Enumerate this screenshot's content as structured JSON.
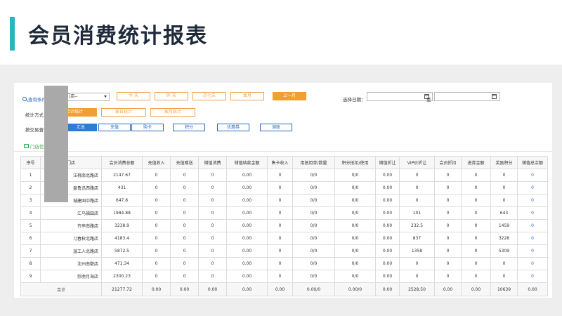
{
  "slide": {
    "title": "会员消费统计报表"
  },
  "query": {
    "label": "查询条件",
    "store_select": "--所有门店--",
    "quick_buttons": [
      {
        "label": "今 天",
        "active": false
      },
      {
        "label": "昨 天",
        "active": false
      },
      {
        "label": "近七天",
        "active": false
      },
      {
        "label": "本月",
        "active": false
      },
      {
        "label": "上一月",
        "active": true
      }
    ],
    "date_label": "选择日期：",
    "date_from": "",
    "date_to": "",
    "date_sep": "至"
  },
  "stat_mode": {
    "label": "统计方式：",
    "buttons": [
      {
        "label": "合计统计",
        "active": true
      },
      {
        "label": "按日统计",
        "active": false
      },
      {
        "label": "按月统计",
        "active": false
      }
    ]
  },
  "trade_query": {
    "label": "按交易查询：",
    "buttons": [
      {
        "label": "汇总",
        "active": true
      },
      {
        "label": "充值",
        "active": false
      },
      {
        "label": "购卡",
        "active": false
      },
      {
        "label": "积分",
        "active": false
      },
      {
        "label": "优惠券",
        "active": false
      },
      {
        "label": "调账",
        "active": false
      }
    ]
  },
  "section_tab": "门店信息",
  "table": {
    "headers": [
      "序号",
      "门店",
      "会员消费总额",
      "充值收入",
      "充值赠送",
      "储值消费",
      "储值结款金额",
      "售卡收入",
      "用抵用劵/数量",
      "积分抵扣/使用",
      "储值折让",
      "VIP价折让",
      "会员折扣",
      "进券金额",
      "奖励积分",
      "储值总余额"
    ],
    "rows": [
      [
        "1",
        "汪桃南北路店",
        "2147.67",
        "0",
        "0",
        "0",
        "0.00",
        "0",
        "0/0",
        "0/0",
        "0.00",
        "0",
        "0",
        "0",
        "0",
        "0"
      ],
      [
        "2",
        "盘鲁迅西路店",
        "431",
        "0",
        "0",
        "0",
        "0.00",
        "0",
        "0/0",
        "0/0",
        "0.00",
        "0",
        "0",
        "0",
        "0",
        "0"
      ],
      [
        "3",
        "城建国中路店",
        "647.8",
        "0",
        "0",
        "0",
        "0.00",
        "0",
        "0/0",
        "0/0",
        "0.00",
        "0",
        "0",
        "0",
        "0",
        "0"
      ],
      [
        "4",
        "汇乌福田店",
        "1984.88",
        "0",
        "0",
        "0",
        "0.00",
        "0",
        "0/0",
        "0/0",
        "0.00",
        "101",
        "0",
        "0",
        "643",
        "0"
      ],
      [
        "5",
        "齐亭南路店",
        "3238.9",
        "0",
        "0",
        "0",
        "0.00",
        "0",
        "0/0",
        "0/0",
        "0.00",
        "232.5",
        "0",
        "0",
        "1459",
        "0"
      ],
      [
        "6",
        "习春秋北路店",
        "4183.4",
        "0",
        "0",
        "0",
        "0.00",
        "0",
        "0/0",
        "0/0",
        "0.00",
        "837",
        "0",
        "0",
        "3228",
        "0"
      ],
      [
        "7",
        "温工人北路店",
        "5872.5",
        "0",
        "0",
        "0",
        "0.00",
        "0",
        "0/0",
        "0/0",
        "0.00",
        "1358",
        "0",
        "0",
        "5309",
        "0"
      ],
      [
        "8",
        "沈州南壁店",
        "471.34",
        "0",
        "0",
        "0",
        "0.00",
        "0",
        "0/0",
        "0/0",
        "0.00",
        "0",
        "0",
        "0",
        "0",
        "0"
      ],
      [
        "9",
        "弥虎月海店",
        "2300.23",
        "0",
        "0",
        "0",
        "0.00",
        "0",
        "0/0",
        "0/0",
        "0.00",
        "0",
        "0",
        "0",
        "0",
        "0"
      ]
    ],
    "total": [
      "合计",
      "21277.72",
      "0.00",
      "0.00",
      "0.00",
      "0.00",
      "0.00",
      "0.00/0",
      "0.00/0",
      "0.00",
      "2528.50",
      "0.00",
      "0.00",
      "10639",
      "0.00"
    ]
  },
  "colors": {
    "accent": "#2ab4c0",
    "orange": "#f0a030",
    "blue": "#2a7fd4",
    "green": "#3aa04a"
  }
}
